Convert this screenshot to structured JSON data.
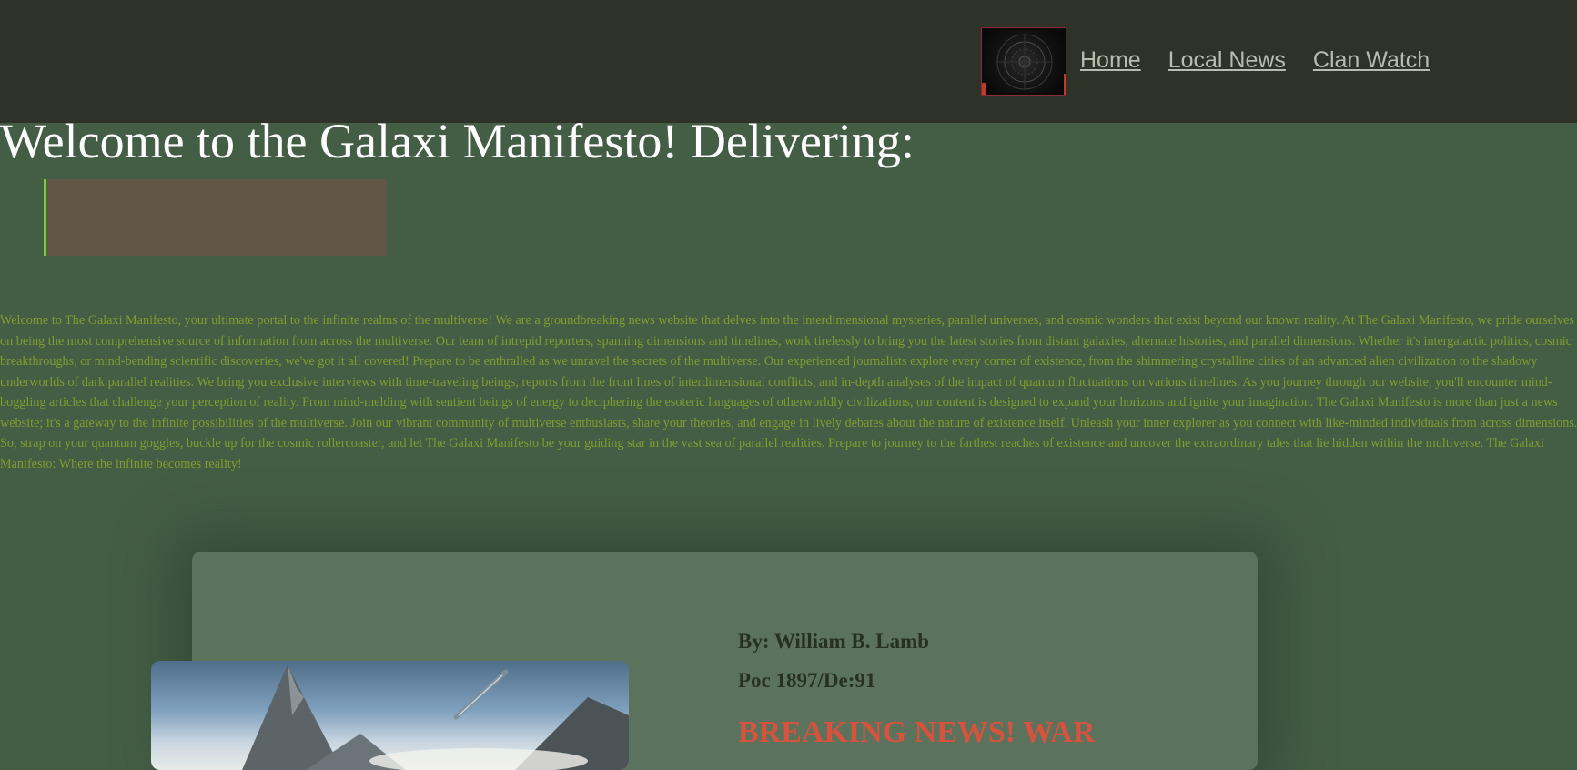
{
  "nav": {
    "logo_icon": "galaxy-sigil-logo",
    "items": [
      {
        "label": "Home"
      },
      {
        "label": "Local News"
      },
      {
        "label": "Clan Watch"
      }
    ]
  },
  "hero": {
    "headline": "Welcome to the Galaxi Manifesto! Delivering:",
    "typing_text": ""
  },
  "intro": {
    "text": "Welcome to The Galaxi Manifesto, your ultimate portal to the infinite realms of the multiverse! We are a groundbreaking news website that delves into the interdimensional mysteries, parallel universes, and cosmic wonders that exist beyond our known reality. At The Galaxi Manifesto, we pride ourselves on being the most comprehensive source of information from across the multiverse. Our team of intrepid reporters, spanning dimensions and timelines, work tirelessly to bring you the latest stories from distant galaxies, alternate histories, and parallel dimensions. Whether it's intergalactic politics, cosmic breakthroughs, or mind-bending scientific discoveries, we've got it all covered! Prepare to be enthralled as we unravel the secrets of the multiverse. Our experienced journalists explore every corner of existence, from the shimmering crystalline cities of an advanced alien civilization to the shadowy underworlds of dark parallel realities. We bring you exclusive interviews with time-traveling beings, reports from the front lines of interdimensional conflicts, and in-depth analyses of the impact of quantum fluctuations on various timelines. As you journey through our website, you'll encounter mind-boggling articles that challenge your perception of reality. From mind-melding with sentient beings of energy to deciphering the esoteric languages of otherworldly civilizations, our content is designed to expand your horizons and ignite your imagination. The Galaxi Manifesto is more than just a news website; it's a gateway to the infinite possibilities of the multiverse. Join our vibrant community of multiverse enthusiasts, share your theories, and engage in lively debates about the nature of existence itself. Unleash your inner explorer as you connect with like-minded individuals from across dimensions. So, strap on your quantum goggles, buckle up for the cosmic rollercoaster, and let The Galaxi Manifesto be your guiding star in the vast sea of parallel realities. Prepare to journey to the farthest reaches of existence and uncover the extraordinary tales that lie hidden within the multiverse. The Galaxi Manifesto: Where the infinite becomes reality!"
  },
  "article": {
    "author": "By: William B. Lamb",
    "date": "Poc 1897/De:91",
    "headline": "BREAKING NEWS! WAR",
    "image_icon": "mountain-spaceship-image"
  },
  "colors": {
    "topbar": "#2f3327",
    "page": "#445d45",
    "card": "#5b735d",
    "intro_text": "#7f9e2e",
    "breaking": "#d9523d",
    "typing_box": "#625646",
    "cursor": "#6fd23a"
  }
}
